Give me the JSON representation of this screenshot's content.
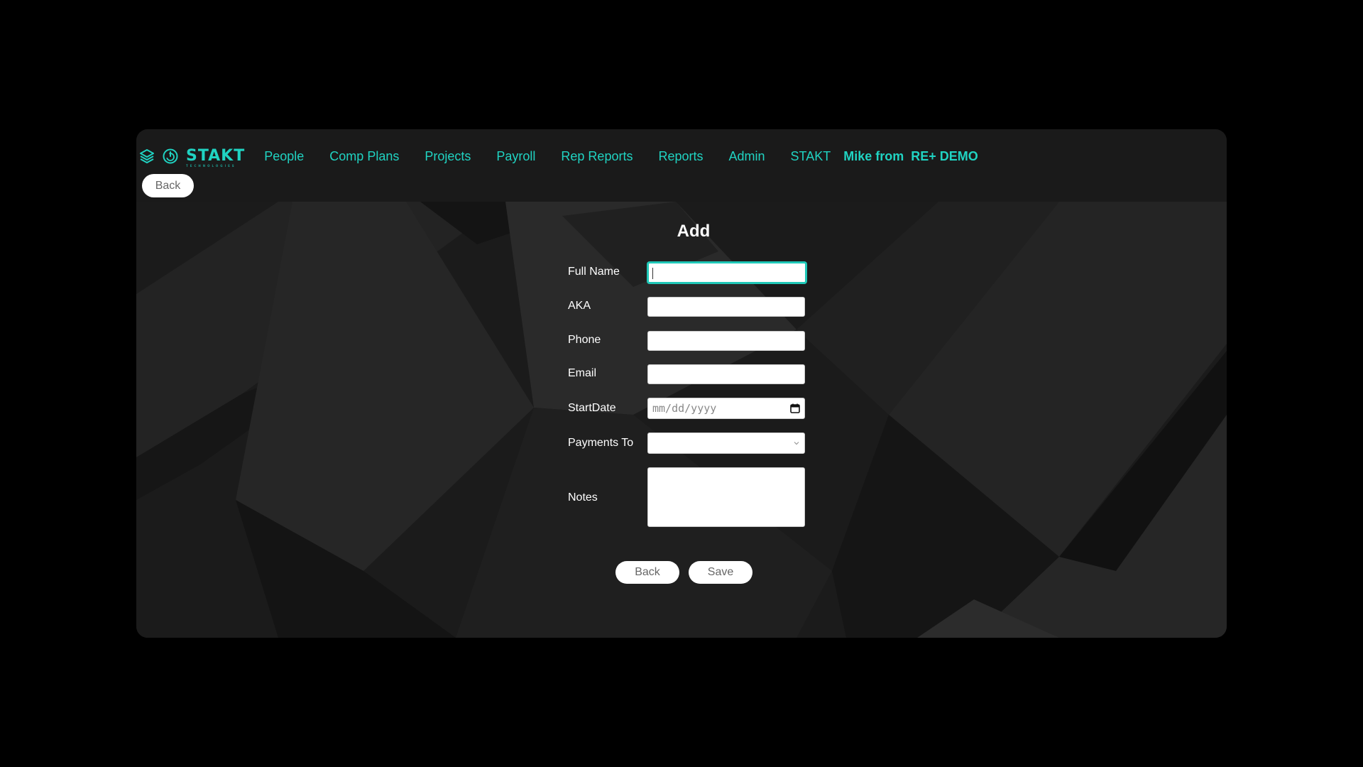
{
  "brand": {
    "logo_text": "STAKT",
    "logo_subtext": "TECHNOLOGIES",
    "accent_color": "#20d3c2",
    "icons": [
      "layers-icon",
      "power-icon"
    ]
  },
  "nav": {
    "items": [
      {
        "label": "People"
      },
      {
        "label": "Comp Plans"
      },
      {
        "label": "Projects"
      },
      {
        "label": "Payroll"
      },
      {
        "label": "Rep Reports"
      },
      {
        "label": "Reports"
      },
      {
        "label": "Admin"
      },
      {
        "label": "STAKT"
      }
    ],
    "user_prefix": "Mike from",
    "user_org": "RE+ DEMO"
  },
  "toolbar": {
    "back_label": "Back"
  },
  "form": {
    "title": "Add",
    "fields": {
      "full_name": {
        "label": "Full Name",
        "value": ""
      },
      "aka": {
        "label": "AKA",
        "value": ""
      },
      "phone": {
        "label": "Phone",
        "value": ""
      },
      "email": {
        "label": "Email",
        "value": ""
      },
      "start_date": {
        "label": "StartDate",
        "placeholder": "mm/dd/yyyy"
      },
      "payments_to": {
        "label": "Payments To",
        "value": ""
      },
      "notes": {
        "label": "Notes",
        "value": ""
      }
    },
    "back_label": "Back",
    "save_label": "Save"
  }
}
